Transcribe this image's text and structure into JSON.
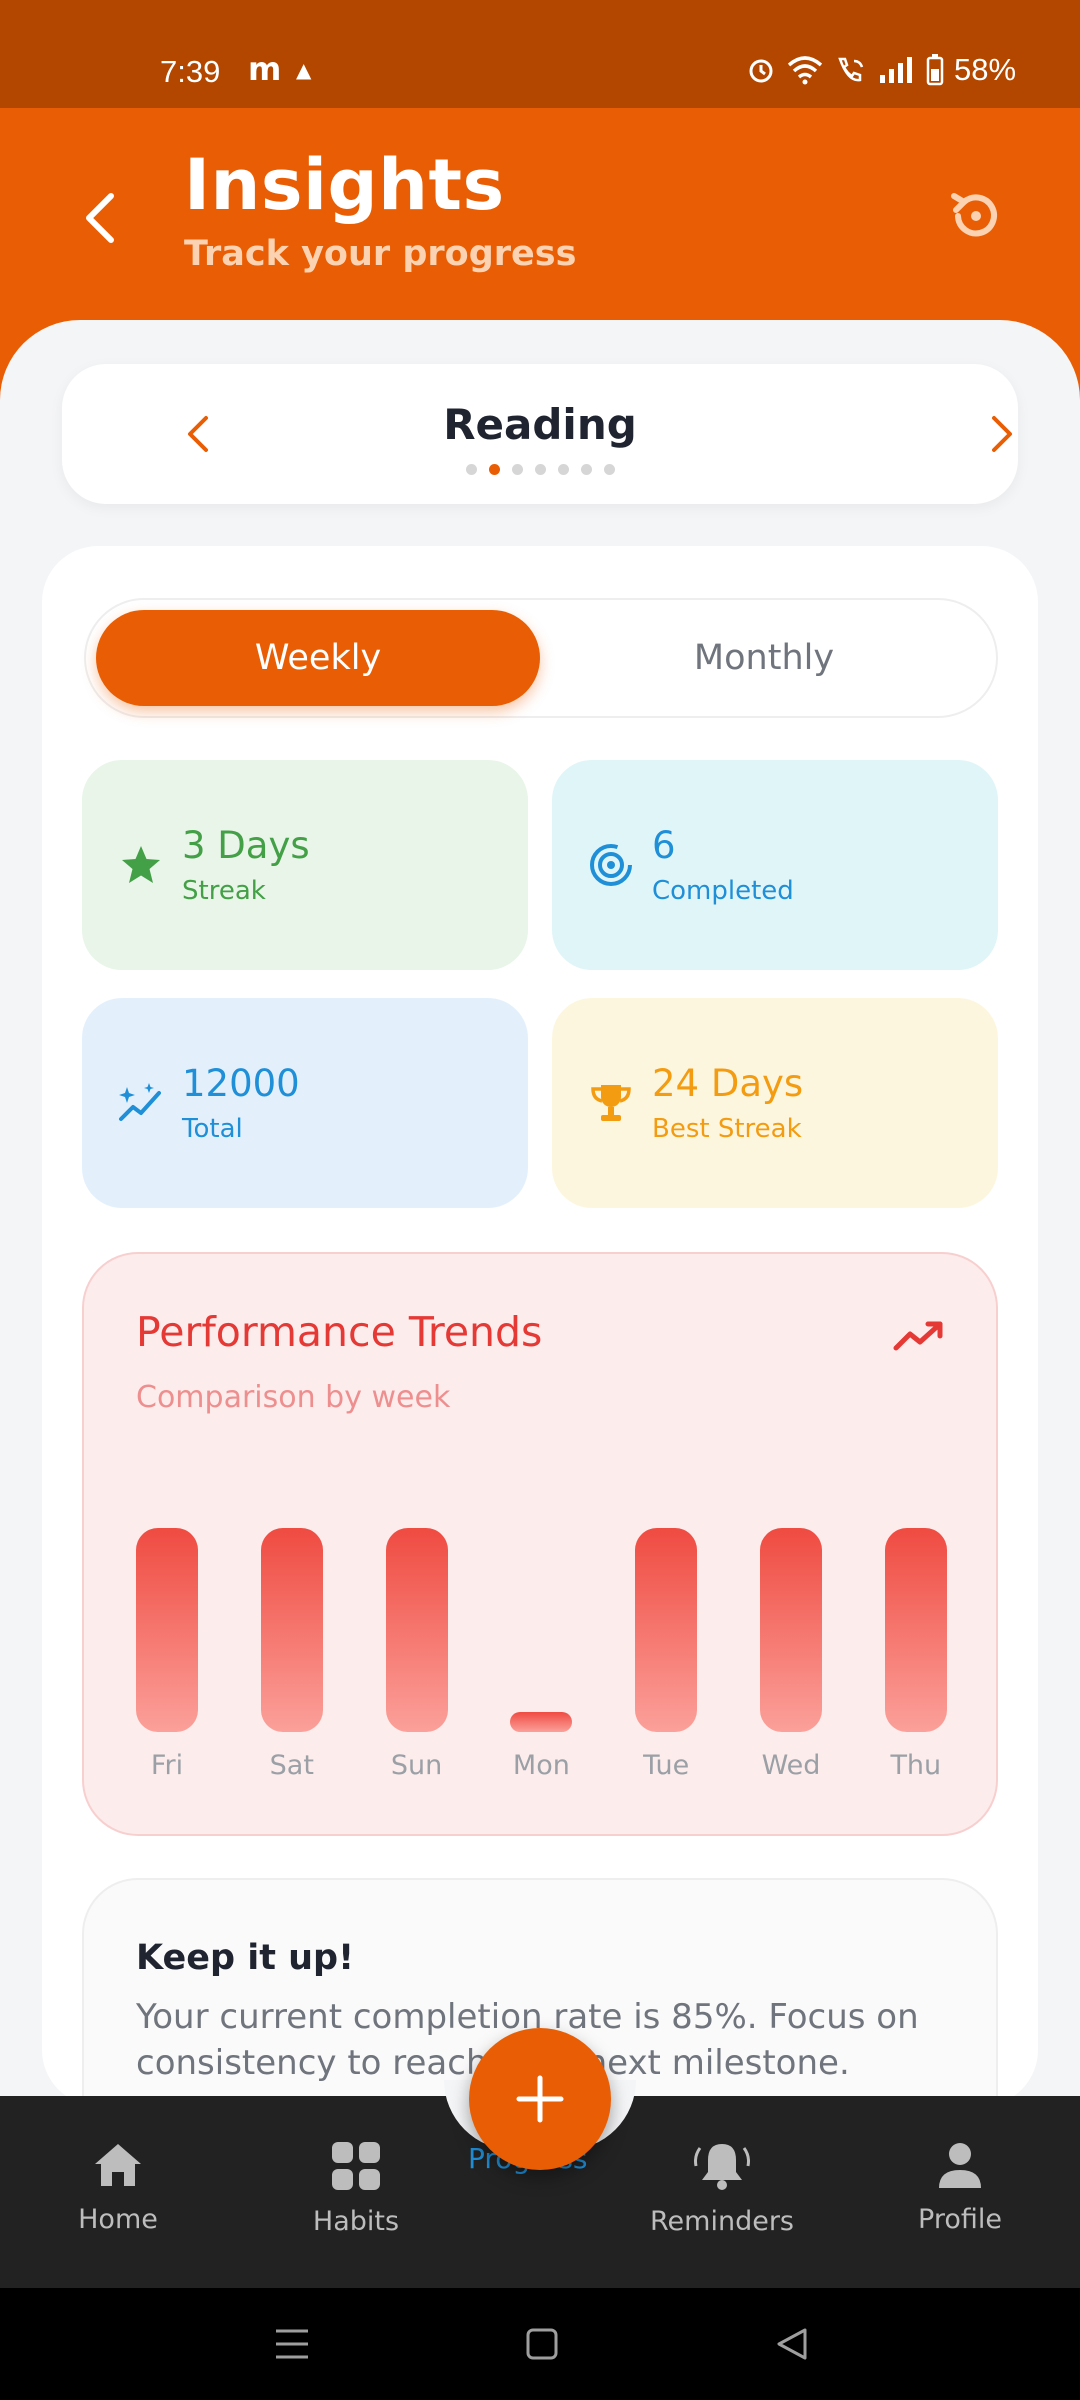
{
  "status_bar": {
    "time": "7:39",
    "app_letter": "m",
    "battery": "58%"
  },
  "header": {
    "title": "Insights",
    "subtitle": "Track your progress"
  },
  "habit_selector": {
    "name": "Reading",
    "dot_count": 7,
    "active_dot": 1
  },
  "period_toggle": {
    "weekly": "Weekly",
    "monthly": "Monthly",
    "selected": "Weekly"
  },
  "stats": {
    "streak": {
      "value": "3 Days",
      "label": "Streak",
      "icon": "star-icon"
    },
    "completed": {
      "value": "6",
      "label": "Completed",
      "icon": "target-icon"
    },
    "total": {
      "value": "12000",
      "label": "Total",
      "icon": "sparkle-trend-icon"
    },
    "best_streak": {
      "value": "24 Days",
      "label": "Best Streak",
      "icon": "trophy-icon"
    }
  },
  "trends": {
    "title": "Performance Trends",
    "subtitle": "Comparison by week"
  },
  "chart_data": {
    "type": "bar",
    "categories": [
      "Fri",
      "Sat",
      "Sun",
      "Mon",
      "Tue",
      "Wed",
      "Thu"
    ],
    "values": [
      1,
      1,
      1,
      0,
      1,
      1,
      1
    ],
    "ylim": [
      0,
      1
    ],
    "grid": false
  },
  "tip": {
    "title": "Keep it up!",
    "text": "Your current completion rate is 85%. Focus on consistency to reach your next milestone."
  },
  "bottom_nav": {
    "home": "Home",
    "habits": "Habits",
    "progress": "Progress",
    "reminders": "Reminders",
    "profile": "Profile"
  },
  "colors": {
    "accent": "#e95e04",
    "status_bar": "#b34700",
    "trend_red": "#e53935"
  }
}
